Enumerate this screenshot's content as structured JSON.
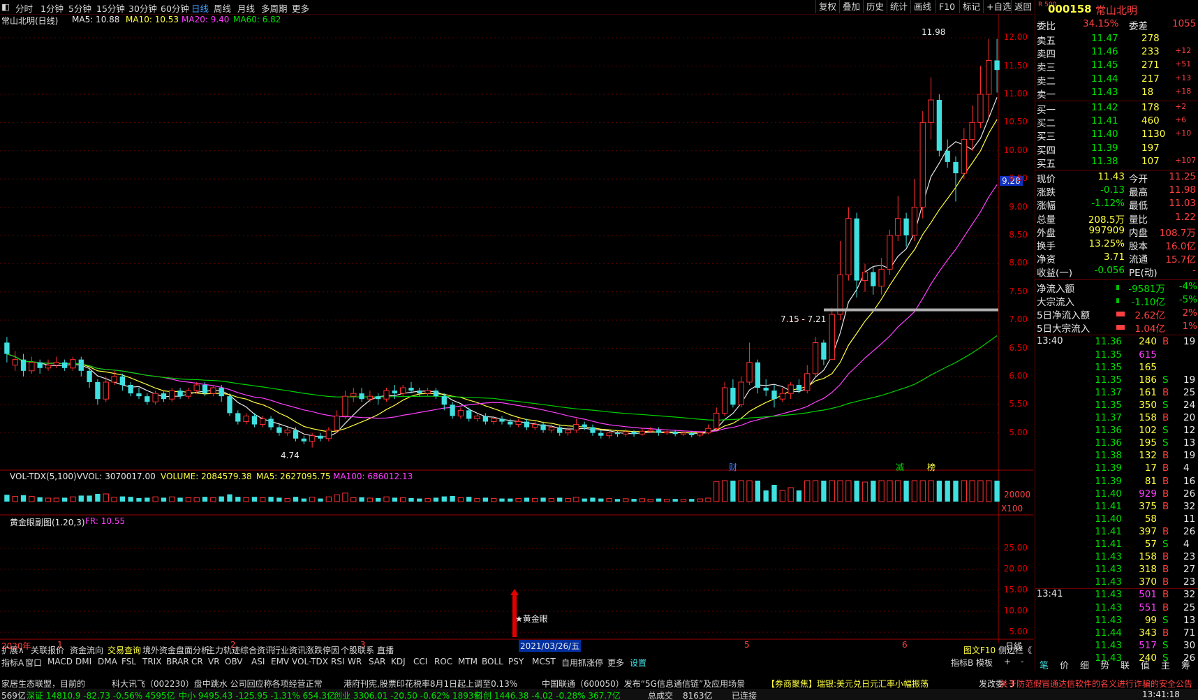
{
  "topbar": {
    "tabs": [
      "分时",
      "1分钟",
      "5分钟",
      "15分钟",
      "30分钟",
      "60分钟",
      "日线",
      "周线",
      "月线",
      "多周期",
      "更多"
    ],
    "active_tab": "日线",
    "right_buttons": [
      "复权",
      "叠加",
      "历史",
      "统计",
      "画线",
      "F10",
      "标记",
      "+自选",
      "返回"
    ]
  },
  "stock": {
    "code": "000158",
    "name": "常山北明",
    "badge": "R 500",
    "chart_title": "常山北明(日线)",
    "ma5": "MA5: 10.88",
    "ma10": "MA10: 10.53",
    "ma20": "MA20: 9.40",
    "ma60": "MA60: 6.82",
    "high_label": "11.98",
    "low_label": "4.74",
    "range_label": "7.15 - 7.21",
    "price_marker": "9.28",
    "event_cai": "财",
    "event_jian": "减",
    "event_bang": "榜"
  },
  "volume": {
    "title": "VOL-TDX(5,100)",
    "vvol": "VVOL: 3070017.00",
    "volume": "VOLUME: 2084579.38",
    "ma5": "MA5: 2627095.75",
    "ma100": "MA100: 686012.13",
    "tick_20000": "20000",
    "tick_x100": "X100"
  },
  "indicator": {
    "title": "黄金眼副图(1.20,3)",
    "fr": "FR: 10.55",
    "ticks": [
      "25.00",
      "20.00",
      "15.00",
      "10.00",
      "5.00"
    ],
    "signal_label": "★黄金眼"
  },
  "yaxis": {
    "ticks": [
      "12.00",
      "11.50",
      "11.00",
      "10.50",
      "10.00",
      "9.50",
      "9.00",
      "8.50",
      "8.00",
      "7.50",
      "7.00",
      "6.50",
      "6.00",
      "5.50",
      "5.00"
    ]
  },
  "xaxis": {
    "labels": [
      "2020年",
      "1",
      "2",
      "3",
      "4",
      "5",
      "6"
    ],
    "cursor_date": "2021/03/26/五",
    "period": "日线"
  },
  "toolbar1": [
    "扩展∧",
    "关联报价",
    "资金流向",
    "交易查询",
    "境外资金",
    "盘面分析",
    "主力轨迹",
    "综合资讯",
    "行业资讯",
    "涨跌停因",
    "个股联系",
    "直播",
    "图文F10",
    "侧边栏《"
  ],
  "toolbar2": [
    "指标A",
    "窗口",
    "MACD",
    "DMI",
    "DMA",
    "FSL",
    "TRIX",
    "BRAR",
    "CR",
    "VR",
    "OBV",
    "ASI",
    "EMV",
    "VOL-TDX",
    "RSI",
    "WR",
    "SAR",
    "KDJ",
    "CCI",
    "ROC",
    "MTM",
    "BOLL",
    "PSY",
    "MCST",
    "自用抓涨停",
    "更多",
    "设置",
    "指标B",
    "模板",
    "+",
    "-"
  ],
  "quote": {
    "weibi_label": "委比",
    "weibi": "34.15%",
    "weicha_label": "委差",
    "weicha": "1055",
    "asks": [
      {
        "label": "卖五",
        "price": "11.47",
        "vol": "278",
        "chg": ""
      },
      {
        "label": "卖四",
        "price": "11.46",
        "vol": "233",
        "chg": "+12"
      },
      {
        "label": "卖三",
        "price": "11.45",
        "vol": "271",
        "chg": "+51"
      },
      {
        "label": "卖二",
        "price": "11.44",
        "vol": "217",
        "chg": "+13"
      },
      {
        "label": "卖一",
        "price": "11.43",
        "vol": "18",
        "chg": "+18"
      }
    ],
    "bids": [
      {
        "label": "买一",
        "price": "11.42",
        "vol": "178",
        "chg": "+2"
      },
      {
        "label": "买二",
        "price": "11.41",
        "vol": "460",
        "chg": "+6"
      },
      {
        "label": "买三",
        "price": "11.40",
        "vol": "1130",
        "chg": "+10"
      },
      {
        "label": "买四",
        "price": "11.39",
        "vol": "197",
        "chg": ""
      },
      {
        "label": "买五",
        "price": "11.38",
        "vol": "107",
        "chg": "+107"
      }
    ],
    "stats": [
      {
        "l1": "现价",
        "v1": "11.43",
        "l2": "今开",
        "v2": "11.25"
      },
      {
        "l1": "涨跌",
        "v1": "-0.13",
        "l2": "最高",
        "v2": "11.98"
      },
      {
        "l1": "涨幅",
        "v1": "-1.12%",
        "l2": "最低",
        "v2": "11.03"
      },
      {
        "l1": "总量",
        "v1": "208.5万",
        "l2": "量比",
        "v2": "1.22"
      },
      {
        "l1": "外盘",
        "v1": "997909",
        "l2": "内盘",
        "v2": "108.7万"
      },
      {
        "l1": "换手",
        "v1": "13.25%",
        "l2": "股本",
        "v2": "16.0亿"
      },
      {
        "l1": "净资",
        "v1": "3.71",
        "l2": "流通",
        "v2": "15.7亿"
      },
      {
        "l1": "收益(一)",
        "v1": "-0.056",
        "l2": "PE(动)",
        "v2": "-"
      }
    ],
    "flows": [
      {
        "label": "净流入额",
        "val": "-9581万",
        "pct": "-4%"
      },
      {
        "label": "大宗流入",
        "val": "-1.10亿",
        "pct": "-5%"
      },
      {
        "label": "5日净流入额",
        "val": "2.62亿",
        "pct": "2%"
      },
      {
        "label": "5日大宗流入",
        "val": "1.04亿",
        "pct": "1%"
      }
    ]
  },
  "ticks": {
    "time1": "13:40",
    "time2": "13:41",
    "rows": [
      {
        "p": "11.36",
        "v": "240",
        "s": "B",
        "n": "19"
      },
      {
        "p": "11.35",
        "v": "615",
        "s": "",
        "n": ""
      },
      {
        "p": "11.35",
        "v": "165",
        "s": "",
        "n": ""
      },
      {
        "p": "11.35",
        "v": "186",
        "s": "S",
        "n": "19"
      },
      {
        "p": "11.37",
        "v": "161",
        "s": "B",
        "n": "25"
      },
      {
        "p": "11.35",
        "v": "350",
        "s": "S",
        "n": "24"
      },
      {
        "p": "11.37",
        "v": "158",
        "s": "B",
        "n": "20"
      },
      {
        "p": "11.36",
        "v": "102",
        "s": "S",
        "n": "12"
      },
      {
        "p": "11.36",
        "v": "195",
        "s": "S",
        "n": "13"
      },
      {
        "p": "11.38",
        "v": "132",
        "s": "B",
        "n": "19"
      },
      {
        "p": "11.39",
        "v": "17",
        "s": "B",
        "n": "4"
      },
      {
        "p": "11.39",
        "v": "81",
        "s": "B",
        "n": "16"
      },
      {
        "p": "11.40",
        "v": "929",
        "s": "B",
        "n": "26"
      },
      {
        "p": "11.41",
        "v": "375",
        "s": "B",
        "n": "32"
      },
      {
        "p": "11.40",
        "v": "58",
        "s": "",
        "n": "11"
      },
      {
        "p": "11.41",
        "v": "397",
        "s": "B",
        "n": "26"
      },
      {
        "p": "11.41",
        "v": "57",
        "s": "S",
        "n": "4"
      },
      {
        "p": "11.43",
        "v": "158",
        "s": "B",
        "n": "23"
      },
      {
        "p": "11.43",
        "v": "318",
        "s": "B",
        "n": "27"
      },
      {
        "p": "11.43",
        "v": "370",
        "s": "B",
        "n": "23"
      },
      {
        "p": "11.43",
        "v": "501",
        "s": "B",
        "n": "32"
      },
      {
        "p": "11.43",
        "v": "551",
        "s": "B",
        "n": "25"
      },
      {
        "p": "11.43",
        "v": "99",
        "s": "S",
        "n": "13"
      },
      {
        "p": "11.44",
        "v": "343",
        "s": "B",
        "n": "71"
      },
      {
        "p": "11.43",
        "v": "517",
        "s": "S",
        "n": "30"
      },
      {
        "p": "11.43",
        "v": "240",
        "s": "S",
        "n": "26"
      }
    ],
    "tabs": [
      "笔",
      "价",
      "细",
      "势",
      "联",
      "值",
      "主",
      "筹"
    ]
  },
  "ticker": {
    "items": [
      "家居生态联盟，目前的",
      "科大讯飞（002230）盘中跳水 公司回应称各项经营正常",
      "港府刊宪,股票印花税率8月1日起上调至0.13%",
      "中国联通（600050）发布“5G信息通信链”及应用场景",
      "【券商聚焦】瑞银:美元兑日元汇率小幅振荡",
      "发改委: 3",
      "关于防范假冒通达信软件的名义进行诈骗的安全公告"
    ]
  },
  "indexbar": {
    "items": [
      "569亿",
      "深证 14810.9 -82.73 -0.56% 4595亿",
      "中小 9495.43 -125.95 -1.31% 654.3亿",
      "创业 3306.01 -20.50 -0.62% 1893亿",
      "科创 1446.38 -4.02 -0.28% 367.7亿",
      "总成交",
      "8163亿",
      "已连接",
      "13:41:18"
    ]
  },
  "chart_data": {
    "type": "candlestick",
    "title": "常山北明(日线)",
    "ylim": [
      4.6,
      12.2
    ],
    "y_ticks": [
      5.0,
      5.5,
      6.0,
      6.5,
      7.0,
      7.5,
      8.0,
      8.5,
      9.0,
      9.5,
      10.0,
      10.5,
      11.0,
      11.5,
      12.0
    ],
    "ohlc": [
      [
        6.6,
        6.4,
        6.7,
        6.25
      ],
      [
        6.2,
        6.3,
        6.45,
        6.1
      ],
      [
        6.3,
        6.1,
        6.4,
        6.0
      ],
      [
        6.1,
        6.25,
        6.35,
        6.05
      ],
      [
        6.25,
        6.15,
        6.3,
        6.05
      ],
      [
        6.15,
        6.2,
        6.3,
        6.1
      ],
      [
        6.2,
        6.25,
        6.35,
        6.15
      ],
      [
        6.25,
        6.15,
        6.3,
        6.1
      ],
      [
        6.15,
        6.3,
        6.35,
        6.1
      ],
      [
        6.3,
        6.1,
        6.35,
        6.0
      ],
      [
        6.1,
        5.9,
        6.15,
        5.8
      ],
      [
        5.9,
        5.6,
        5.95,
        5.5
      ],
      [
        5.6,
        5.9,
        6.0,
        5.55
      ],
      [
        5.9,
        6.0,
        6.1,
        5.85
      ],
      [
        6.0,
        5.85,
        6.05,
        5.75
      ],
      [
        5.85,
        5.7,
        5.9,
        5.65
      ],
      [
        5.7,
        5.65,
        5.8,
        5.6
      ],
      [
        5.65,
        5.55,
        5.7,
        5.5
      ],
      [
        5.55,
        5.7,
        5.75,
        5.5
      ],
      [
        5.7,
        5.6,
        5.75,
        5.55
      ],
      [
        5.6,
        5.75,
        5.8,
        5.55
      ],
      [
        5.75,
        5.65,
        5.8,
        5.6
      ],
      [
        5.65,
        5.75,
        5.8,
        5.6
      ],
      [
        5.75,
        5.85,
        5.9,
        5.7
      ],
      [
        5.85,
        5.7,
        5.9,
        5.65
      ],
      [
        5.7,
        5.8,
        5.85,
        5.65
      ],
      [
        5.8,
        5.65,
        5.85,
        5.55
      ],
      [
        5.65,
        5.35,
        5.7,
        5.3
      ],
      [
        5.35,
        5.2,
        5.4,
        5.15
      ],
      [
        5.2,
        5.3,
        5.35,
        5.15
      ],
      [
        5.3,
        5.15,
        5.35,
        5.1
      ],
      [
        5.15,
        5.25,
        5.3,
        5.1
      ],
      [
        5.25,
        5.1,
        5.3,
        5.05
      ],
      [
        5.1,
        5.0,
        5.15,
        4.95
      ],
      [
        5.0,
        5.05,
        5.1,
        4.95
      ],
      [
        5.05,
        4.9,
        5.1,
        4.85
      ],
      [
        4.9,
        4.85,
        4.95,
        4.8
      ],
      [
        4.85,
        4.95,
        5.0,
        4.74
      ],
      [
        4.95,
        4.9,
        5.0,
        4.85
      ],
      [
        4.9,
        5.05,
        5.1,
        4.85
      ],
      [
        5.05,
        5.3,
        5.4,
        5.0
      ],
      [
        5.3,
        5.65,
        5.75,
        5.25
      ],
      [
        5.65,
        5.7,
        5.8,
        5.55
      ],
      [
        5.7,
        5.6,
        5.8,
        5.55
      ],
      [
        5.6,
        5.65,
        5.75,
        5.55
      ],
      [
        5.65,
        5.6,
        5.7,
        5.5
      ],
      [
        5.6,
        5.75,
        5.8,
        5.55
      ],
      [
        5.75,
        5.7,
        5.85,
        5.6
      ],
      [
        5.7,
        5.8,
        5.85,
        5.65
      ],
      [
        5.8,
        5.75,
        5.9,
        5.7
      ],
      [
        5.75,
        5.7,
        5.8,
        5.65
      ],
      [
        5.7,
        5.75,
        5.8,
        5.65
      ],
      [
        5.75,
        5.65,
        5.8,
        5.6
      ],
      [
        5.65,
        5.5,
        5.7,
        5.4
      ],
      [
        5.5,
        5.3,
        5.55,
        5.25
      ],
      [
        5.3,
        5.4,
        5.45,
        5.25
      ],
      [
        5.4,
        5.25,
        5.45,
        5.2
      ],
      [
        5.25,
        5.3,
        5.35,
        5.2
      ],
      [
        5.3,
        5.2,
        5.35,
        5.15
      ],
      [
        5.2,
        5.25,
        5.3,
        5.15
      ],
      [
        5.25,
        5.2,
        5.3,
        5.15
      ],
      [
        5.2,
        5.15,
        5.25,
        5.1
      ],
      [
        5.15,
        5.2,
        5.25,
        5.1
      ],
      [
        5.2,
        5.1,
        5.25,
        5.05
      ],
      [
        5.1,
        5.15,
        5.2,
        5.05
      ],
      [
        5.15,
        5.05,
        5.2,
        5.0
      ],
      [
        5.05,
        5.1,
        5.15,
        5.0
      ],
      [
        5.1,
        5.0,
        5.15,
        4.95
      ],
      [
        5.0,
        5.05,
        5.1,
        4.95
      ],
      [
        5.05,
        5.15,
        5.25,
        5.0
      ],
      [
        5.15,
        5.1,
        5.2,
        5.05
      ],
      [
        5.1,
        5.0,
        5.15,
        4.95
      ],
      [
        5.0,
        4.95,
        5.05,
        4.9
      ],
      [
        4.95,
        5.0,
        5.05,
        4.9
      ],
      [
        5.0,
        4.98,
        5.05,
        4.93
      ],
      [
        4.98,
        5.02,
        5.07,
        4.93
      ],
      [
        5.02,
        4.98,
        5.05,
        4.93
      ],
      [
        4.98,
        5.03,
        5.08,
        4.95
      ],
      [
        5.03,
        5.05,
        5.1,
        5.0
      ],
      [
        5.05,
        5.0,
        5.1,
        4.95
      ],
      [
        5.0,
        5.02,
        5.06,
        4.96
      ],
      [
        5.02,
        4.98,
        5.05,
        4.94
      ],
      [
        4.98,
        5.0,
        5.04,
        4.95
      ],
      [
        5.0,
        4.96,
        5.03,
        4.92
      ],
      [
        4.96,
        5.0,
        5.04,
        4.92
      ],
      [
        5.0,
        5.08,
        5.15,
        4.98
      ],
      [
        5.08,
        5.35,
        5.45,
        5.05
      ],
      [
        5.35,
        5.8,
        5.9,
        5.3
      ],
      [
        5.8,
        5.5,
        5.95,
        5.45
      ],
      [
        5.5,
        5.9,
        6.0,
        5.45
      ],
      [
        5.9,
        6.25,
        6.6,
        5.85
      ],
      [
        6.25,
        5.8,
        6.3,
        5.7
      ],
      [
        5.8,
        5.75,
        5.95,
        5.65
      ],
      [
        5.75,
        5.6,
        5.85,
        5.45
      ],
      [
        5.6,
        5.7,
        5.8,
        5.55
      ],
      [
        5.7,
        5.85,
        5.9,
        5.6
      ],
      [
        5.85,
        5.75,
        5.95,
        5.7
      ],
      [
        5.75,
        6.05,
        6.2,
        5.7
      ],
      [
        6.05,
        6.6,
        6.7,
        6.0
      ],
      [
        6.6,
        6.3,
        6.65,
        6.2
      ],
      [
        6.3,
        7.1,
        7.21,
        6.9
      ],
      [
        7.1,
        7.8,
        8.4,
        7.0
      ],
      [
        7.8,
        8.8,
        9.0,
        7.7
      ],
      [
        8.8,
        7.7,
        8.9,
        7.4
      ],
      [
        7.7,
        7.85,
        8.0,
        7.5
      ],
      [
        7.85,
        7.6,
        7.95,
        7.45
      ],
      [
        7.6,
        7.9,
        8.1,
        7.45
      ],
      [
        7.9,
        8.5,
        8.6,
        7.8
      ],
      [
        8.5,
        8.8,
        9.2,
        8.4
      ],
      [
        8.8,
        8.5,
        8.9,
        8.3
      ],
      [
        8.5,
        9.0,
        9.5,
        8.4
      ],
      [
        9.0,
        10.5,
        10.7,
        8.8
      ],
      [
        10.5,
        10.9,
        11.3,
        10.2
      ],
      [
        10.9,
        10.0,
        11.0,
        9.9
      ],
      [
        10.0,
        9.8,
        10.2,
        9.7
      ],
      [
        9.8,
        9.6,
        9.9,
        9.1
      ],
      [
        9.6,
        10.2,
        10.4,
        9.5
      ],
      [
        10.2,
        10.5,
        10.8,
        10.0
      ],
      [
        10.5,
        11.0,
        11.5,
        10.4
      ],
      [
        11.0,
        11.6,
        11.98,
        10.6
      ],
      [
        11.6,
        11.43,
        11.98,
        11.03
      ]
    ]
  }
}
